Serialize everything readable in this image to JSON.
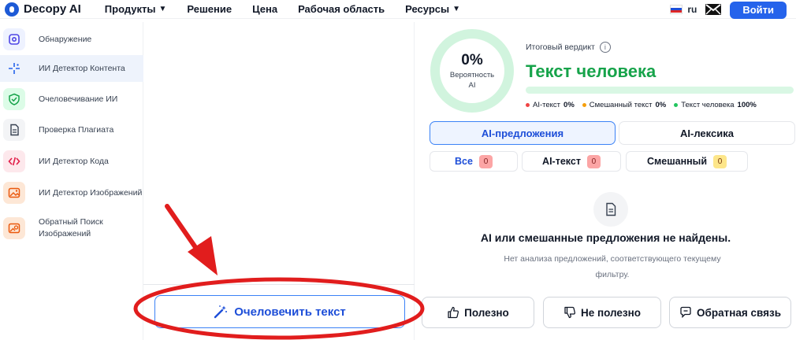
{
  "brand": {
    "name": "Decopy AI"
  },
  "nav": {
    "items": [
      {
        "label": "Продукты",
        "dropdown": true
      },
      {
        "label": "Решение",
        "dropdown": false
      },
      {
        "label": "Цена",
        "dropdown": false
      },
      {
        "label": "Рабочая область",
        "dropdown": false
      },
      {
        "label": "Ресурсы",
        "dropdown": true
      }
    ],
    "lang": "ru",
    "login_label": "Войти"
  },
  "sidebar": {
    "items": [
      {
        "label": "Обнаружение",
        "icon": "detect-icon",
        "active": false
      },
      {
        "label": "ИИ Детектор Контента",
        "icon": "ai-sparkle-icon",
        "active": true
      },
      {
        "label": "Очеловечивание ИИ",
        "icon": "shield-check-icon",
        "active": false
      },
      {
        "label": "Проверка Плагиата",
        "icon": "document-icon",
        "active": false
      },
      {
        "label": "ИИ Детектор Кода",
        "icon": "code-icon",
        "active": false
      },
      {
        "label": "ИИ Детектор Изображений",
        "icon": "image-icon",
        "active": false
      },
      {
        "label": "Обратный Поиск",
        "label2": "Изображений",
        "icon": "image-search-icon",
        "active": false
      }
    ]
  },
  "main": {
    "humanize_label": "Очеловечить текст"
  },
  "result": {
    "percent": "0%",
    "percent_label_line1": "Вероятность",
    "percent_label_line2": "AI",
    "verdict_label": "Итоговый вердикт",
    "verdict": "Текст человека",
    "legend": [
      {
        "label": "AI-текст",
        "value": "0%",
        "color": "#ef4444"
      },
      {
        "label": "Смешанный текст",
        "value": "0%",
        "color": "#f59e0b"
      },
      {
        "label": "Текст человека",
        "value": "100%",
        "color": "#22c55e"
      }
    ],
    "tabs": [
      "AI-предложения",
      "AI-лексика"
    ],
    "filters": [
      {
        "label": "Все",
        "count": "0"
      },
      {
        "label": "AI-текст",
        "count": "0"
      },
      {
        "label": "Смешанный",
        "count": "0"
      }
    ],
    "empty_title": "AI или смешанные предложения не найдены.",
    "empty_sub": "Нет анализа предложений, соответствующего текущему фильтру.",
    "feedback": [
      "Полезно",
      "Не полезно",
      "Обратная связь"
    ]
  },
  "colors": {
    "accent": "#2563eb",
    "human": "#16a34a",
    "annotation": "#e11d1d"
  }
}
